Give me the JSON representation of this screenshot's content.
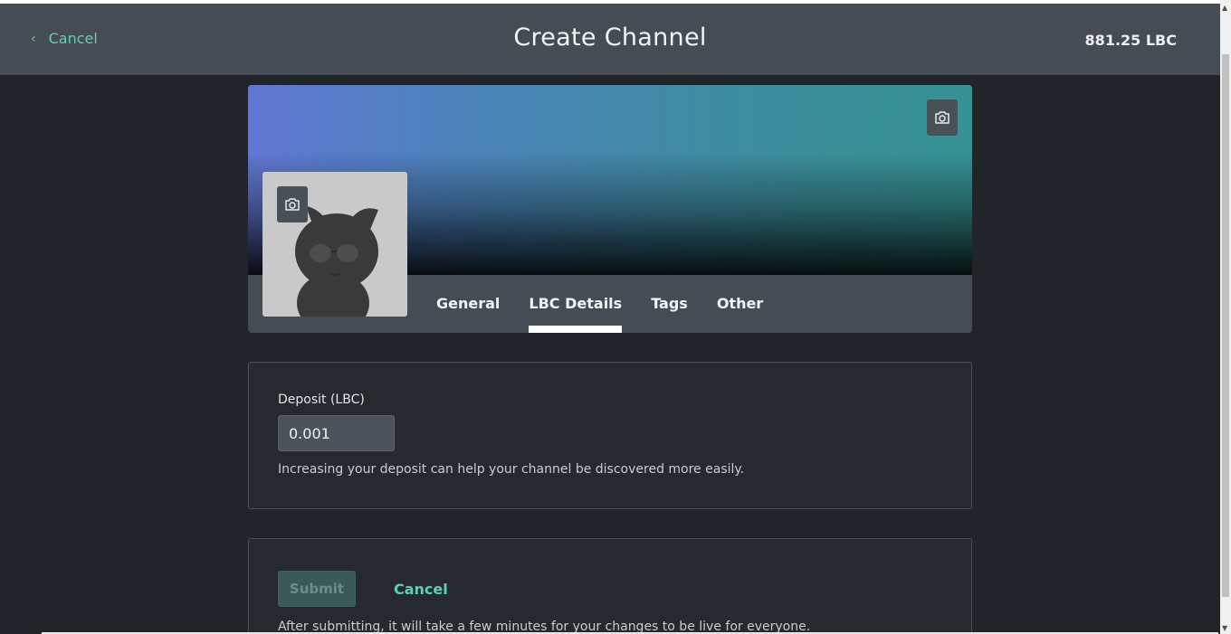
{
  "header": {
    "back_label": "Cancel",
    "title": "Create Channel",
    "balance": "881.25 LBC"
  },
  "cover": {
    "tabs": [
      {
        "label": "General",
        "active": false
      },
      {
        "label": "LBC Details",
        "active": true
      },
      {
        "label": "Tags",
        "active": false
      },
      {
        "label": "Other",
        "active": false
      }
    ]
  },
  "deposit": {
    "label": "Deposit (LBC)",
    "value": "0.001",
    "help": "Increasing your deposit can help your channel be discovered more easily."
  },
  "actions": {
    "submit_label": "Submit",
    "cancel_label": "Cancel",
    "note": "After submitting, it will take a few minutes for your changes to be live for everyone."
  },
  "colors": {
    "accent": "#5fcfb3",
    "background": "#212529",
    "header": "#464c53"
  }
}
